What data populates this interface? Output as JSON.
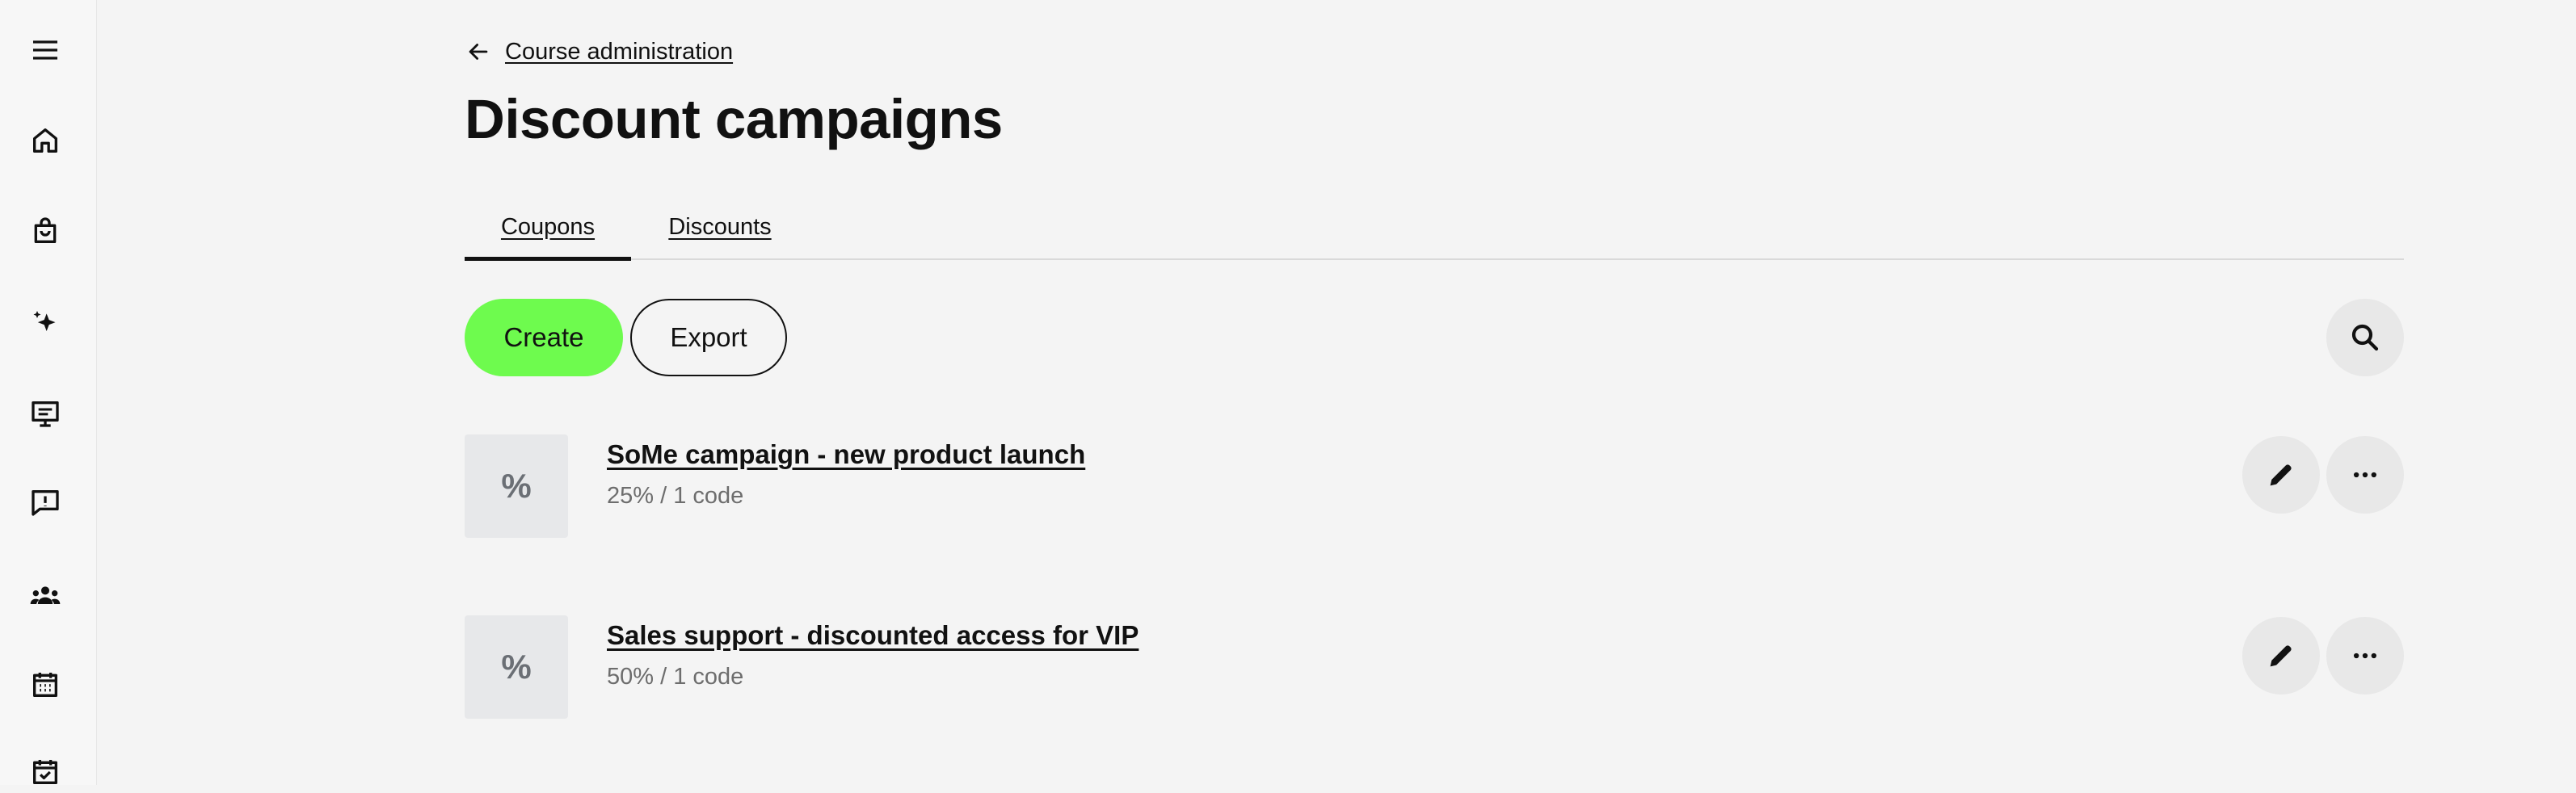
{
  "sidebar": {
    "items": [
      {
        "icon": "menu-icon"
      },
      {
        "icon": "home-icon"
      },
      {
        "icon": "shopping-bag-icon"
      },
      {
        "icon": "sparkle-icon"
      },
      {
        "icon": "course-screen-icon"
      },
      {
        "icon": "feedback-icon"
      },
      {
        "icon": "users-icon"
      },
      {
        "icon": "calendar-icon"
      },
      {
        "icon": "calendar-check-icon"
      }
    ]
  },
  "breadcrumb": {
    "back_icon": "arrow-left-icon",
    "label": "Course administration"
  },
  "page": {
    "title": "Discount campaigns"
  },
  "tabs": [
    {
      "label": "Coupons",
      "active": true
    },
    {
      "label": "Discounts",
      "active": false
    }
  ],
  "toolbar": {
    "create_label": "Create",
    "export_label": "Export",
    "search_icon": "search-icon",
    "create_color": "#6efb4e"
  },
  "campaigns": [
    {
      "icon_text": "%",
      "title": "SoMe campaign - new product launch",
      "subtitle": "25% / 1 code"
    },
    {
      "icon_text": "%",
      "title": "Sales support - discounted access for VIP",
      "subtitle": "50% / 1 code"
    }
  ]
}
